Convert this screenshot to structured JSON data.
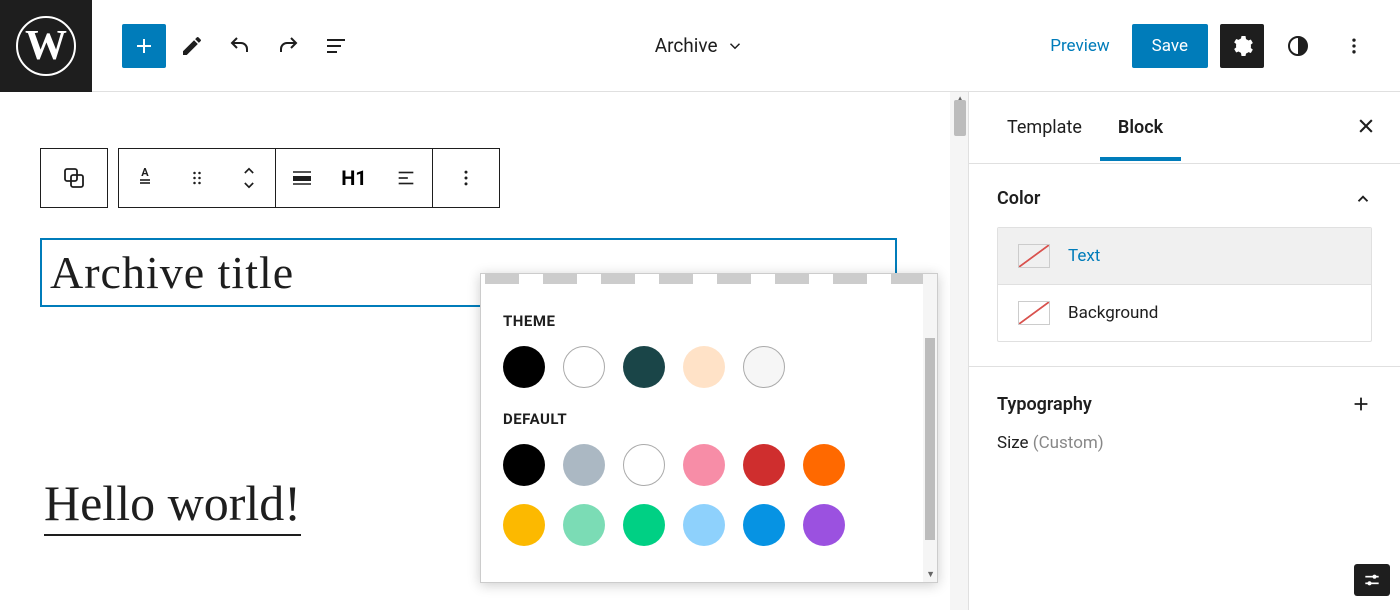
{
  "header": {
    "title": "Archive",
    "preview": "Preview",
    "save": "Save"
  },
  "blockToolbar": {
    "heading": "H1"
  },
  "editor": {
    "archiveTitle": "Archive title",
    "postTitle": "Hello world!"
  },
  "colorPopover": {
    "theme_label": "THEME",
    "default_label": "DEFAULT",
    "theme": [
      "#000000",
      "#ffffff",
      "#1a4548",
      "#ffe2c7",
      "#f6f6f6"
    ],
    "default_row1": [
      "#000000",
      "#abb8c3",
      "#ffffff",
      "#f78da7",
      "#cf2e2e",
      "#ff6900"
    ],
    "default_row2": [
      "#fcb900",
      "#7bdcb5",
      "#00d084",
      "#8ed1fc",
      "#0693e3",
      "#9b51e0"
    ]
  },
  "sidebar": {
    "tabs": {
      "template": "Template",
      "block": "Block"
    },
    "color": {
      "title": "Color",
      "text": "Text",
      "background": "Background"
    },
    "typography": {
      "title": "Typography",
      "size_label": "Size",
      "size_value": "(Custom)"
    }
  }
}
